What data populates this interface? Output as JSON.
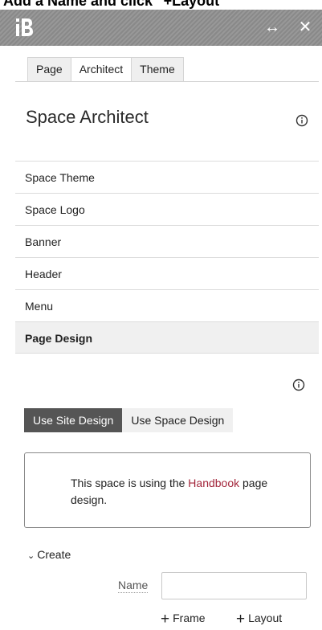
{
  "caption": "Add a Name and click \"+Layout\"",
  "topbar": {
    "logo_icon": "builder-b-logo-icon",
    "resize_icon": "↔",
    "close_icon": "✕",
    "bg_color": "#909090"
  },
  "tabs": [
    {
      "label": "Page",
      "active": false
    },
    {
      "label": "Architect",
      "active": true
    },
    {
      "label": "Theme",
      "active": false
    }
  ],
  "panel": {
    "title": "Space Architect",
    "info_icon": "info-circle-icon"
  },
  "menu": {
    "items": [
      {
        "label": "Space Theme",
        "active": false
      },
      {
        "label": "Space Logo",
        "active": false
      },
      {
        "label": "Banner",
        "active": false
      },
      {
        "label": "Header",
        "active": false
      },
      {
        "label": "Menu",
        "active": false
      },
      {
        "label": "Page Design",
        "active": true
      }
    ]
  },
  "design": {
    "use_site_label": "Use Site Design",
    "use_space_label": "Use Space Design",
    "selected": "Use Site Design",
    "selected_color": "#555555",
    "notice_prefix": "This space is using the ",
    "notice_link": "Handbook",
    "notice_suffix": " page design.",
    "link_color": "#a3263b"
  },
  "create": {
    "chevron": "⌄",
    "label": "Create",
    "name_label": "Name",
    "name_value": "",
    "frame_label": "Frame",
    "layout_label": "Layout",
    "plus_icon": "+"
  }
}
